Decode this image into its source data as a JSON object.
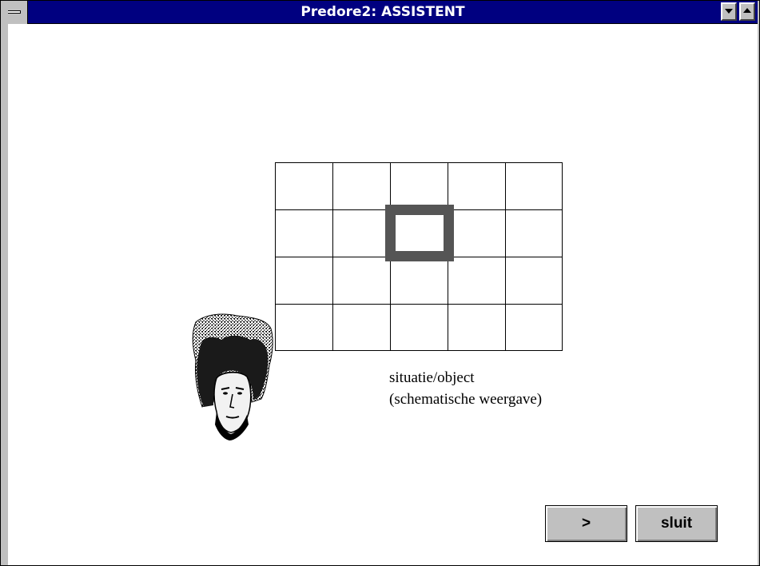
{
  "window": {
    "title": "Predore2: ASSISTENT",
    "titlebar_color": "#000080",
    "controls": {
      "system_menu_icon": "system-menu-icon",
      "minimize_icon": "triangle-down-icon",
      "maximize_icon": "triangle-up-icon"
    }
  },
  "diagram": {
    "columns": 5,
    "rows": 4,
    "highlighted_cell": {
      "row": 2,
      "column": 3
    },
    "highlight_color": "#555555"
  },
  "assistant": {
    "portrait_icon": "assistant-portrait"
  },
  "caption": {
    "line1": "situatie/object",
    "line2": "(schematische weergave)"
  },
  "buttons": {
    "next_label": ">",
    "close_label": "sluit"
  }
}
